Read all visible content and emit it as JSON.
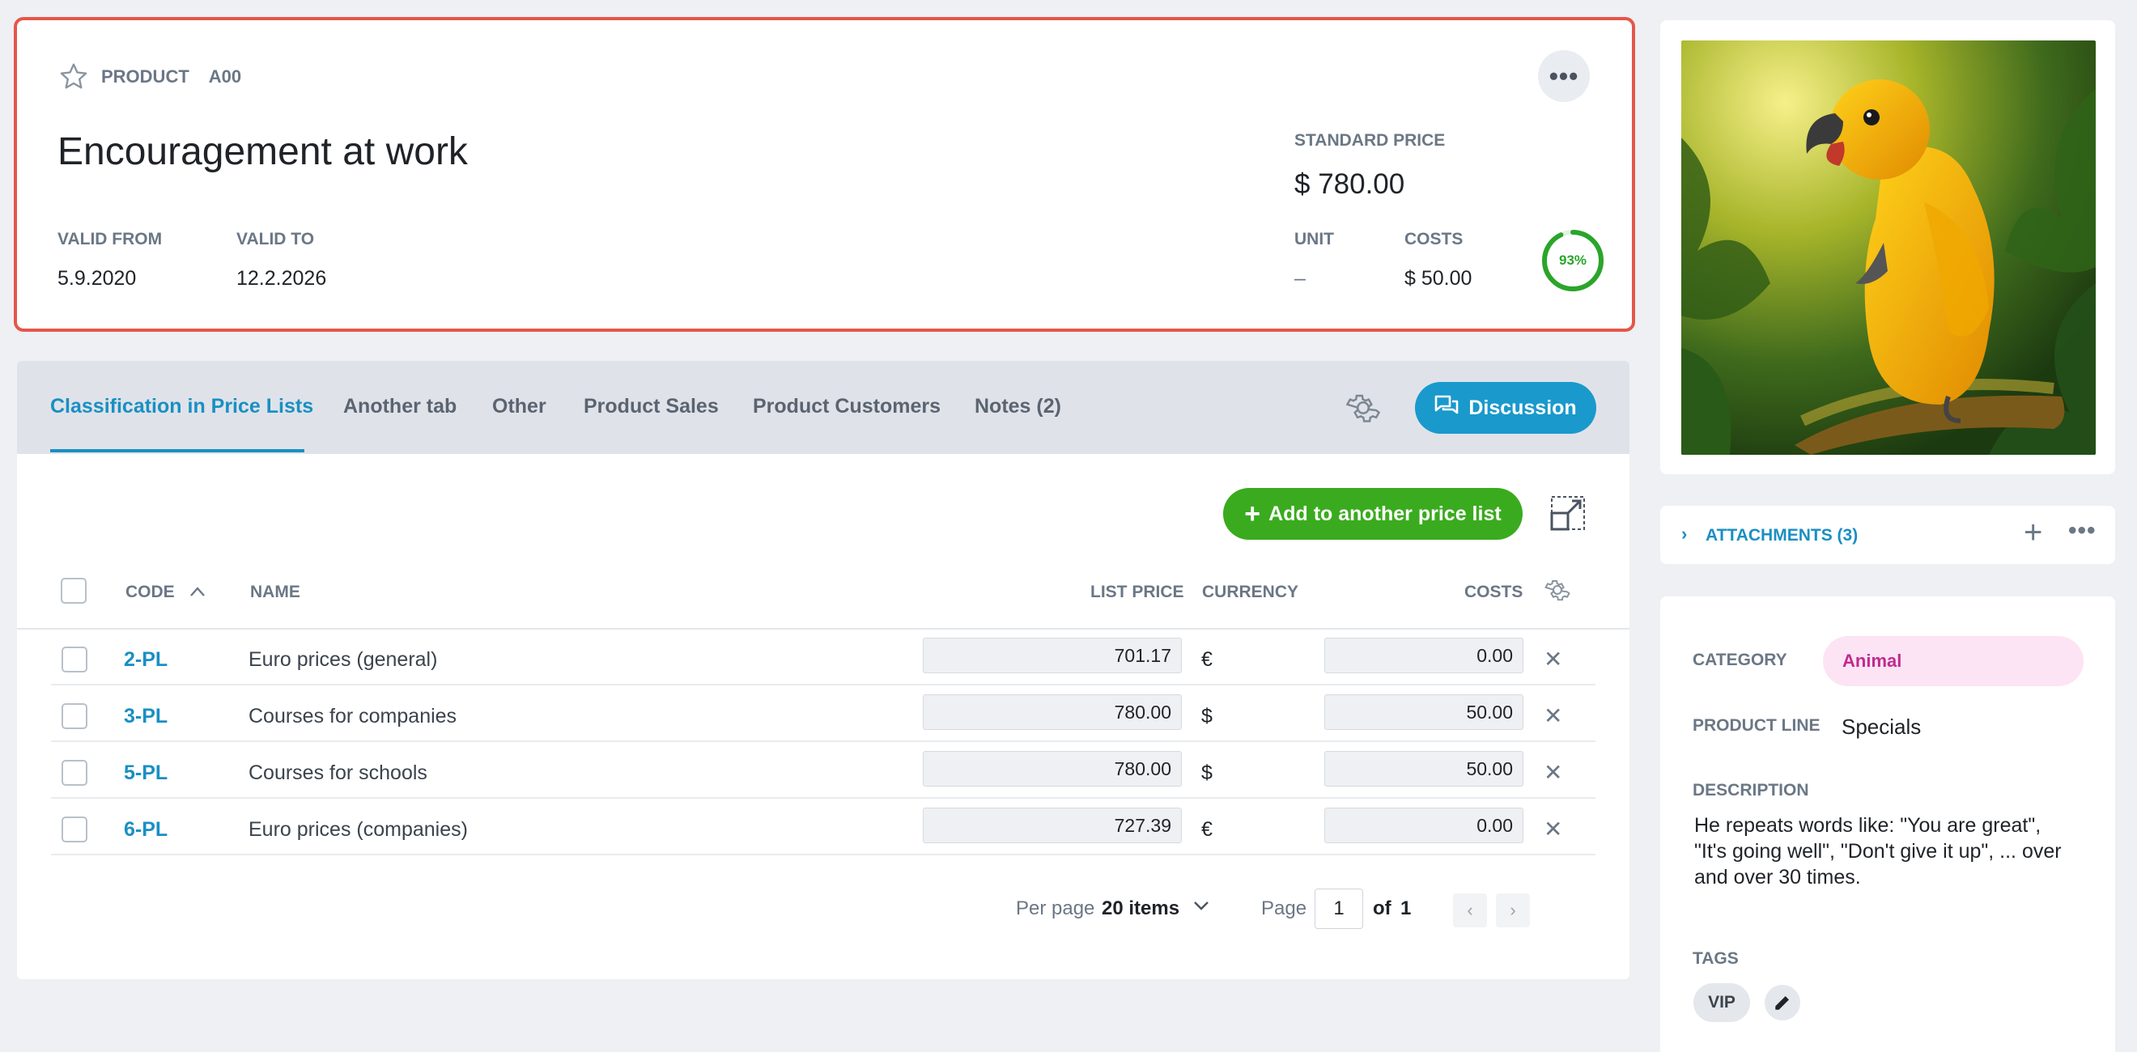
{
  "header": {
    "type_label": "PRODUCT",
    "code": "A00",
    "more_label": "•••",
    "title": "Encouragement at work",
    "valid_from_label": "VALID FROM",
    "valid_from": "5.9.2020",
    "valid_to_label": "VALID TO",
    "valid_to": "12.2.2026",
    "standard_price_label": "STANDARD PRICE",
    "standard_price": "$ 780.00",
    "unit_label": "UNIT",
    "unit": "–",
    "costs_label": "COSTS",
    "costs": "$ 50.00",
    "margin_percent": 93,
    "margin_text": "93%"
  },
  "tabs": [
    {
      "label": "Classification in Price Lists",
      "active": true
    },
    {
      "label": "Another tab"
    },
    {
      "label": "Other"
    },
    {
      "label": "Product Sales"
    },
    {
      "label": "Product Customers"
    },
    {
      "label": "Notes (2)"
    }
  ],
  "discussion_label": "Discussion",
  "add_button_label": "Add to another price list",
  "table": {
    "columns": {
      "code": "CODE",
      "name": "NAME",
      "list_price": "LIST PRICE",
      "currency": "CURRENCY",
      "costs": "COSTS"
    },
    "rows": [
      {
        "code": "2-PL",
        "name": "Euro prices (general)",
        "list_price": "701.17",
        "currency": "€",
        "costs": "0.00"
      },
      {
        "code": "3-PL",
        "name": "Courses for companies",
        "list_price": "780.00",
        "currency": "$",
        "costs": "50.00"
      },
      {
        "code": "5-PL",
        "name": "Courses for schools",
        "list_price": "780.00",
        "currency": "$",
        "costs": "50.00"
      },
      {
        "code": "6-PL",
        "name": "Euro prices (companies)",
        "list_price": "727.39",
        "currency": "€",
        "costs": "0.00"
      }
    ],
    "remove_symbol": "✕"
  },
  "pager": {
    "per_page_label": "Per page",
    "per_page_value": "20 items",
    "page_label": "Page",
    "page_value": "1",
    "of_label": "of",
    "total_pages": "1"
  },
  "attachments": {
    "label": "ATTACHMENTS (3)",
    "add_symbol": "+",
    "more_symbol": "•••"
  },
  "details": {
    "category_label": "CATEGORY",
    "category": "Animal",
    "product_line_label": "PRODUCT LINE",
    "product_line": "Specials",
    "description_label": "DESCRIPTION",
    "description": "He repeats words like: \"You are great\", \"It's going well\", \"Don't give it up\", ... over and over 30 times.",
    "tags_label": "TAGS",
    "tag": "VIP"
  },
  "colors": {
    "accent": "#1a8fc3",
    "primary_button": "#1a99cc",
    "add_button": "#3aab1e",
    "header_border": "#e5564a",
    "gauge": "#2aa52a",
    "category_bg": "#fce4f4",
    "category_text": "#c12a8f"
  },
  "icons": {
    "favorite": "star-icon",
    "settings": "gear-icon",
    "discussion": "chat-icon",
    "expand": "expand-icon",
    "sort": "chevron-up-icon",
    "remove": "close-icon",
    "edit": "pencil-icon"
  }
}
